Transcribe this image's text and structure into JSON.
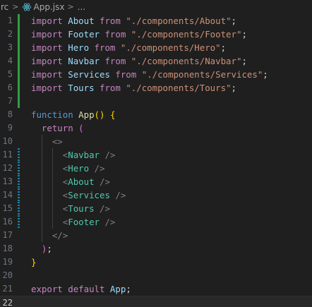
{
  "breadcrumb": {
    "folder": "rc",
    "separator": ">",
    "file": "App.jsx",
    "symbol": "..."
  },
  "editor": {
    "active_line": 22,
    "line_numbers": [
      "1",
      "2",
      "3",
      "4",
      "5",
      "6",
      "7",
      "8",
      "9",
      "10",
      "11",
      "12",
      "13",
      "14",
      "15",
      "16",
      "17",
      "18",
      "19",
      "20",
      "21",
      "22"
    ],
    "lines": [
      [
        {
          "t": "import",
          "c": "kw"
        },
        {
          "t": " "
        },
        {
          "t": "About",
          "c": "id"
        },
        {
          "t": " "
        },
        {
          "t": "from",
          "c": "kw"
        },
        {
          "t": " "
        },
        {
          "t": "\"./components/About\"",
          "c": "str"
        },
        {
          "t": ";"
        }
      ],
      [
        {
          "t": "import",
          "c": "kw"
        },
        {
          "t": " "
        },
        {
          "t": "Footer",
          "c": "id"
        },
        {
          "t": " "
        },
        {
          "t": "from",
          "c": "kw"
        },
        {
          "t": " "
        },
        {
          "t": "\"./components/Footer\"",
          "c": "str"
        },
        {
          "t": ";"
        }
      ],
      [
        {
          "t": "import",
          "c": "kw"
        },
        {
          "t": " "
        },
        {
          "t": "Hero",
          "c": "id"
        },
        {
          "t": " "
        },
        {
          "t": "from",
          "c": "kw"
        },
        {
          "t": " "
        },
        {
          "t": "\"./components/Hero\"",
          "c": "str"
        },
        {
          "t": ";"
        }
      ],
      [
        {
          "t": "import",
          "c": "kw"
        },
        {
          "t": " "
        },
        {
          "t": "Navbar",
          "c": "id"
        },
        {
          "t": " "
        },
        {
          "t": "from",
          "c": "kw"
        },
        {
          "t": " "
        },
        {
          "t": "\"./components/Navbar\"",
          "c": "str"
        },
        {
          "t": ";"
        }
      ],
      [
        {
          "t": "import",
          "c": "kw"
        },
        {
          "t": " "
        },
        {
          "t": "Services",
          "c": "id"
        },
        {
          "t": " "
        },
        {
          "t": "from",
          "c": "kw"
        },
        {
          "t": " "
        },
        {
          "t": "\"./components/Services\"",
          "c": "str"
        },
        {
          "t": ";"
        }
      ],
      [
        {
          "t": "import",
          "c": "kw"
        },
        {
          "t": " "
        },
        {
          "t": "Tours",
          "c": "id"
        },
        {
          "t": " "
        },
        {
          "t": "from",
          "c": "kw"
        },
        {
          "t": " "
        },
        {
          "t": "\"./components/Tours\"",
          "c": "str"
        },
        {
          "t": ";"
        }
      ],
      [],
      [
        {
          "t": "function",
          "c": "decl"
        },
        {
          "t": " "
        },
        {
          "t": "App",
          "c": "fn"
        },
        {
          "t": "(",
          "c": "brace"
        },
        {
          "t": ")",
          "c": "brace"
        },
        {
          "t": " "
        },
        {
          "t": "{",
          "c": "brace"
        }
      ],
      [
        {
          "t": "  "
        },
        {
          "t": "return",
          "c": "ctl"
        },
        {
          "t": " "
        },
        {
          "t": "(",
          "c": "paren"
        }
      ],
      [
        {
          "t": "    "
        },
        {
          "t": "<>",
          "c": "punct"
        }
      ],
      [
        {
          "t": "      "
        },
        {
          "t": "<",
          "c": "punct"
        },
        {
          "t": "Navbar",
          "c": "tag"
        },
        {
          "t": " "
        },
        {
          "t": "/>",
          "c": "punct"
        }
      ],
      [
        {
          "t": "      "
        },
        {
          "t": "<",
          "c": "punct"
        },
        {
          "t": "Hero",
          "c": "tag"
        },
        {
          "t": " "
        },
        {
          "t": "/>",
          "c": "punct"
        }
      ],
      [
        {
          "t": "      "
        },
        {
          "t": "<",
          "c": "punct"
        },
        {
          "t": "About",
          "c": "tag"
        },
        {
          "t": " "
        },
        {
          "t": "/>",
          "c": "punct"
        }
      ],
      [
        {
          "t": "      "
        },
        {
          "t": "<",
          "c": "punct"
        },
        {
          "t": "Services",
          "c": "tag"
        },
        {
          "t": " "
        },
        {
          "t": "/>",
          "c": "punct"
        }
      ],
      [
        {
          "t": "      "
        },
        {
          "t": "<",
          "c": "punct"
        },
        {
          "t": "Tours",
          "c": "tag"
        },
        {
          "t": " "
        },
        {
          "t": "/>",
          "c": "punct"
        }
      ],
      [
        {
          "t": "      "
        },
        {
          "t": "<",
          "c": "punct"
        },
        {
          "t": "Footer",
          "c": "tag"
        },
        {
          "t": " "
        },
        {
          "t": "/>",
          "c": "punct"
        }
      ],
      [
        {
          "t": "    "
        },
        {
          "t": "</>",
          "c": "punct"
        }
      ],
      [
        {
          "t": "  "
        },
        {
          "t": ")",
          "c": "paren"
        },
        {
          "t": ";"
        }
      ],
      [
        {
          "t": "}",
          "c": "brace"
        }
      ],
      [],
      [
        {
          "t": "export",
          "c": "kw"
        },
        {
          "t": " "
        },
        {
          "t": "default",
          "c": "kw"
        },
        {
          "t": " "
        },
        {
          "t": "App",
          "c": "id"
        },
        {
          "t": ";"
        }
      ],
      []
    ],
    "gutter": {
      "added_lines": [
        1,
        2,
        3,
        4,
        5,
        6,
        7
      ],
      "modified_lines": [
        11,
        12,
        13,
        14,
        15,
        16
      ]
    },
    "colors": {
      "keyword": "#c586c0",
      "declaration": "#569cd6",
      "identifier": "#9cdcfe",
      "string": "#ce9178",
      "function": "#dcdcaa",
      "component_tag": "#4ec9b0",
      "jsx_punctuation": "#808080",
      "background": "#1f1f1f",
      "git_added": "#2ea043",
      "git_modified": "#1b81a8"
    }
  }
}
